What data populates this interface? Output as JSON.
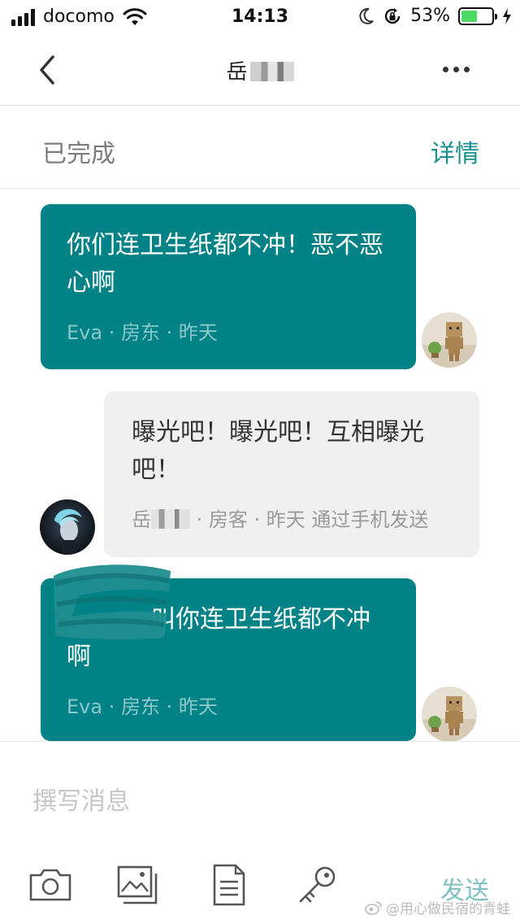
{
  "status_bar": {
    "carrier": "docomo",
    "time": "14:13",
    "battery_percent": "53%",
    "battery_level": 0.53,
    "icons": [
      "signal-icon",
      "wifi-icon",
      "moon-icon",
      "rotation-lock-icon",
      "battery-icon",
      "charging-icon"
    ]
  },
  "nav": {
    "title": "岳",
    "back_icon": "chevron-left-icon",
    "more_icon": "more-horizontal-icon"
  },
  "reservation": {
    "status": "已完成",
    "details_link": "详情"
  },
  "messages": [
    {
      "role": "host",
      "text": "你们连卫生纸都不冲！恶不恶心啊",
      "meta": "Eva · 房东 · 昨天"
    },
    {
      "role": "guest",
      "text": "曝光吧！曝光吧！互相曝光吧！",
      "meta_name": "岳",
      "meta_rest": " · 房客 · 昨天 通过手机发送"
    },
    {
      "role": "host",
      "text": "叫你连卫生纸都不冲啊",
      "meta": "Eva · 房东 · 昨天"
    }
  ],
  "composer": {
    "placeholder": "撰写消息",
    "send_label": "发送",
    "tools": [
      "camera-icon",
      "image-icon",
      "document-icon",
      "key-icon"
    ]
  },
  "watermark": "@用心做民宿的青蛙",
  "colors": {
    "host_bubble": "#008286",
    "guest_bubble": "#f0f0f0",
    "accent": "#1a8f8f",
    "send": "#7fc0c2"
  }
}
